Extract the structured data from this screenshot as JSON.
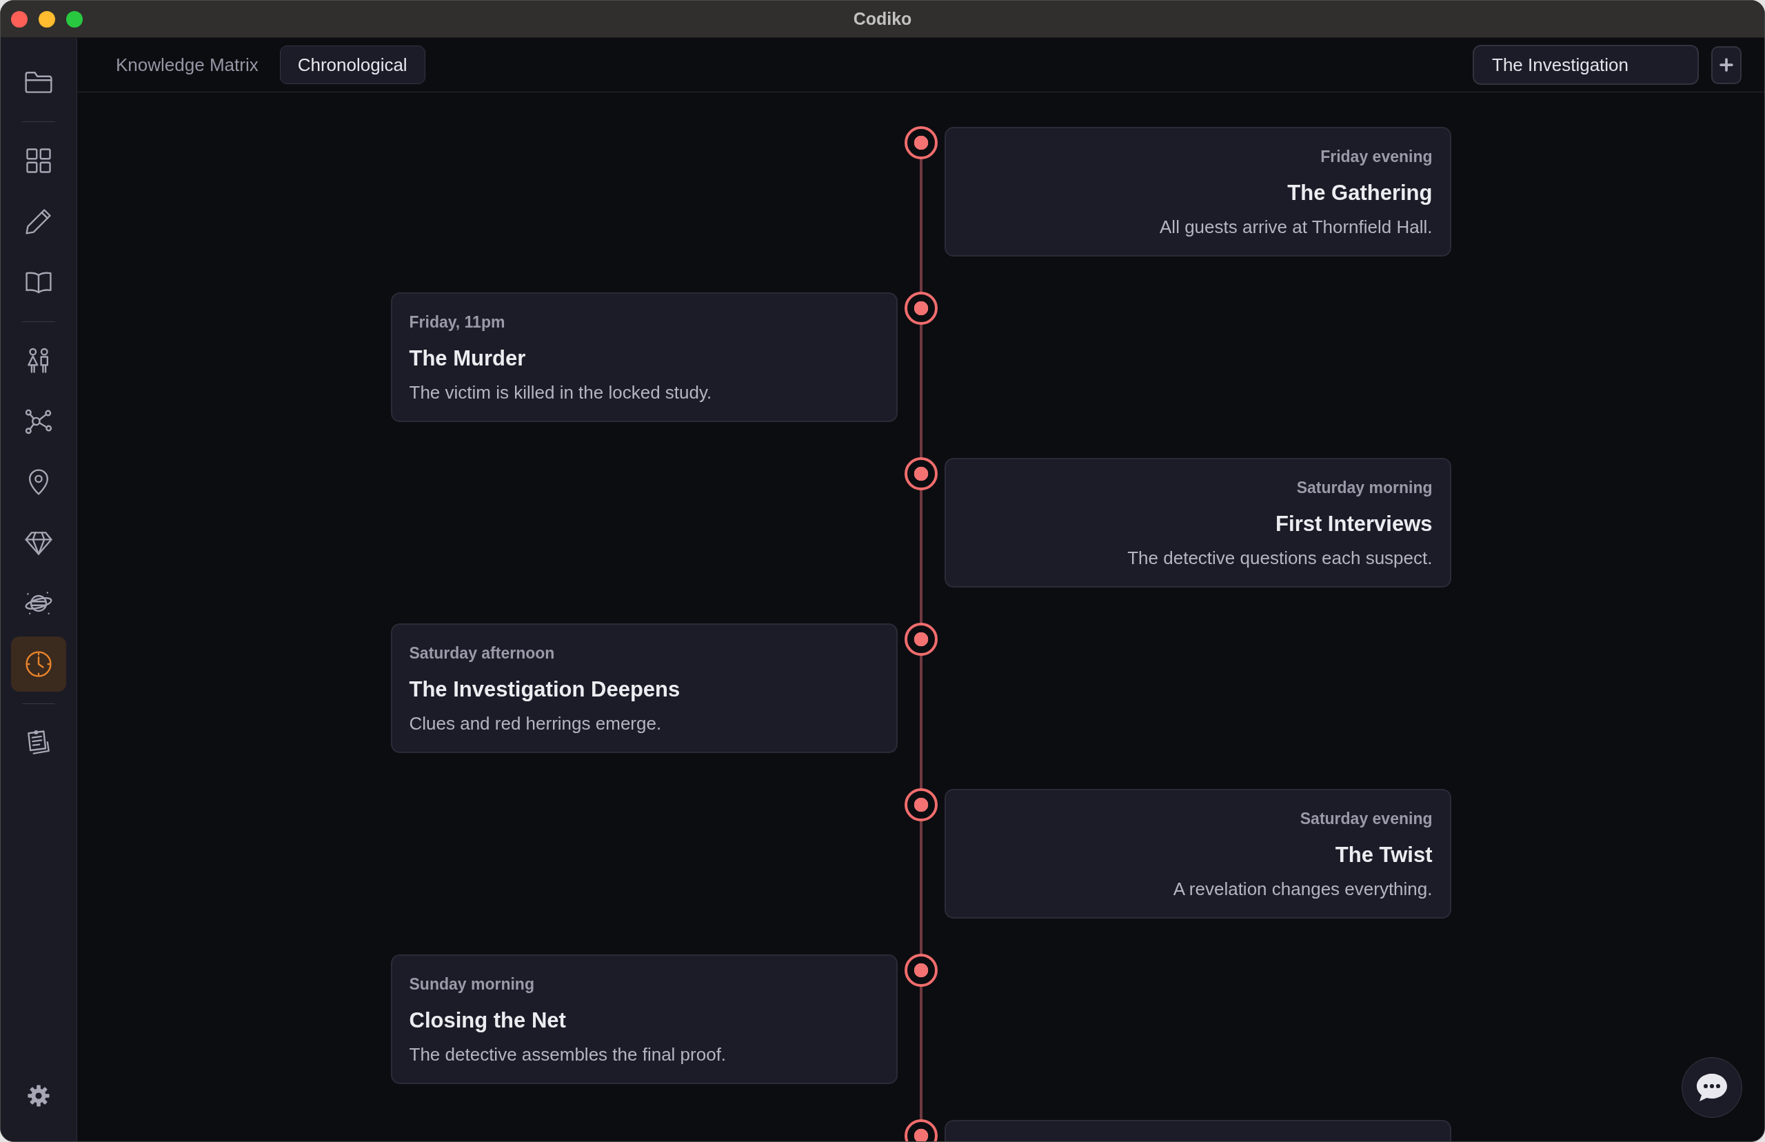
{
  "window": {
    "title": "Codiko"
  },
  "sidebar": {
    "groups": [
      {
        "items": [
          {
            "selected": false
          }
        ]
      },
      {
        "items": [
          {
            "selected": false
          },
          {
            "selected": false
          },
          {
            "selected": false
          }
        ]
      },
      {
        "items": [
          {
            "selected": false
          },
          {
            "selected": false
          },
          {
            "selected": false
          },
          {
            "selected": false
          },
          {
            "selected": false
          },
          {
            "selected": true
          }
        ]
      },
      {
        "items": [
          {
            "selected": false
          }
        ]
      }
    ]
  },
  "view_tabs": [
    {
      "label": "Knowledge Matrix",
      "selected": false
    },
    {
      "label": "Chronological",
      "selected": true
    }
  ],
  "story_field": {
    "value": "The Investigation"
  },
  "timeline": {
    "events": [
      {
        "time": "Friday evening",
        "title": "The Gathering",
        "description": "All guests arrive at Thornfield Hall."
      },
      {
        "time": "Friday, 11pm",
        "title": "The Murder",
        "description": "The victim is killed in the locked study."
      },
      {
        "time": "Saturday morning",
        "title": "First Interviews",
        "description": "The detective questions each suspect."
      },
      {
        "time": "Saturday afternoon",
        "title": "The Investigation Deepens",
        "description": "Clues and red herrings emerge."
      },
      {
        "time": "Saturday evening",
        "title": "The Twist",
        "description": "A revelation changes everything."
      },
      {
        "time": "Sunday morning",
        "title": "Closing the Net",
        "description": "The detective assembles the final proof."
      }
    ],
    "continues": true
  }
}
